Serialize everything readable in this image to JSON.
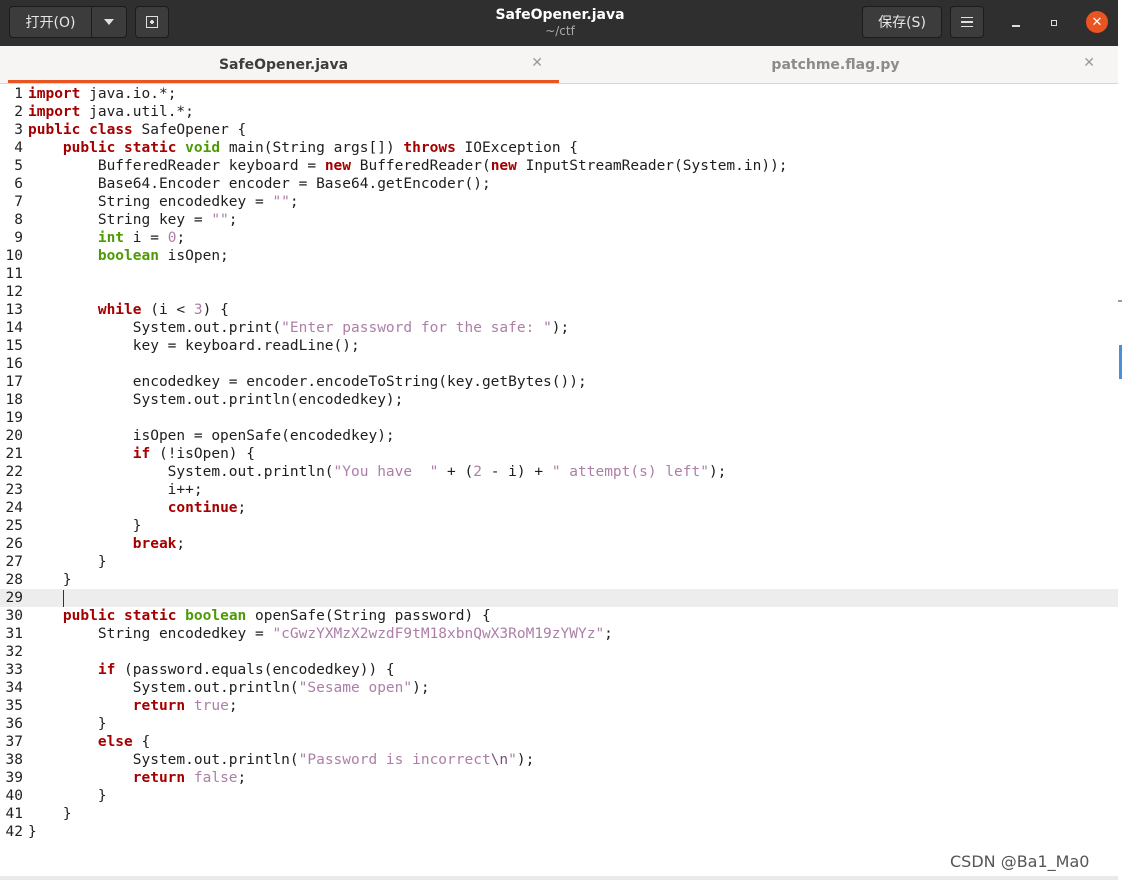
{
  "header": {
    "open_label": "打开(O)",
    "save_label": "保存(S)",
    "title": "SafeOpener.java",
    "subtitle": "~/ctf",
    "close_glyph": "✕"
  },
  "tabs": [
    {
      "label": "SafeOpener.java",
      "active": true
    },
    {
      "label": "patchme.flag.py",
      "active": false
    }
  ],
  "tab_close_glyph": "✕",
  "editor": {
    "current_line": 29,
    "lines": [
      {
        "n": "1",
        "segs": [
          [
            "kw",
            "import"
          ],
          [
            "p",
            " java.io.*;"
          ]
        ]
      },
      {
        "n": "2",
        "segs": [
          [
            "kw",
            "import"
          ],
          [
            "p",
            " java.util.*;"
          ]
        ]
      },
      {
        "n": "3",
        "segs": [
          [
            "kw",
            "public"
          ],
          [
            "p",
            " "
          ],
          [
            "kw",
            "class"
          ],
          [
            "p",
            " SafeOpener {"
          ]
        ]
      },
      {
        "n": "4",
        "segs": [
          [
            "p",
            "    "
          ],
          [
            "kw",
            "public"
          ],
          [
            "p",
            " "
          ],
          [
            "kw",
            "static"
          ],
          [
            "p",
            " "
          ],
          [
            "ty",
            "void"
          ],
          [
            "p",
            " main(String args[]) "
          ],
          [
            "kw",
            "throws"
          ],
          [
            "p",
            " IOException {"
          ]
        ]
      },
      {
        "n": "5",
        "segs": [
          [
            "p",
            "        BufferedReader keyboard = "
          ],
          [
            "kw",
            "new"
          ],
          [
            "p",
            " BufferedReader("
          ],
          [
            "kw",
            "new"
          ],
          [
            "p",
            " InputStreamReader(System.in));"
          ]
        ]
      },
      {
        "n": "6",
        "segs": [
          [
            "p",
            "        Base64.Encoder encoder = Base64.getEncoder();"
          ]
        ]
      },
      {
        "n": "7",
        "segs": [
          [
            "p",
            "        String encodedkey = "
          ],
          [
            "str",
            "\"\""
          ],
          [
            "p",
            ";"
          ]
        ]
      },
      {
        "n": "8",
        "segs": [
          [
            "p",
            "        String key = "
          ],
          [
            "str",
            "\"\""
          ],
          [
            "p",
            ";"
          ]
        ]
      },
      {
        "n": "9",
        "segs": [
          [
            "p",
            "        "
          ],
          [
            "ty",
            "int"
          ],
          [
            "p",
            " i = "
          ],
          [
            "num",
            "0"
          ],
          [
            "p",
            ";"
          ]
        ]
      },
      {
        "n": "10",
        "segs": [
          [
            "p",
            "        "
          ],
          [
            "ty",
            "boolean"
          ],
          [
            "p",
            " isOpen;"
          ]
        ]
      },
      {
        "n": "11",
        "segs": []
      },
      {
        "n": "12",
        "segs": []
      },
      {
        "n": "13",
        "segs": [
          [
            "p",
            "        "
          ],
          [
            "kw",
            "while"
          ],
          [
            "p",
            " (i < "
          ],
          [
            "num",
            "3"
          ],
          [
            "p",
            ") {"
          ]
        ]
      },
      {
        "n": "14",
        "segs": [
          [
            "p",
            "            System.out.print("
          ],
          [
            "str",
            "\"Enter password for the safe: \""
          ],
          [
            "p",
            ");"
          ]
        ]
      },
      {
        "n": "15",
        "segs": [
          [
            "p",
            "            key = keyboard.readLine();"
          ]
        ]
      },
      {
        "n": "16",
        "segs": []
      },
      {
        "n": "17",
        "segs": [
          [
            "p",
            "            encodedkey = encoder.encodeToString(key.getBytes());"
          ]
        ]
      },
      {
        "n": "18",
        "segs": [
          [
            "p",
            "            System.out.println(encodedkey);"
          ]
        ]
      },
      {
        "n": "19",
        "segs": []
      },
      {
        "n": "20",
        "segs": [
          [
            "p",
            "            isOpen = openSafe(encodedkey);"
          ]
        ]
      },
      {
        "n": "21",
        "segs": [
          [
            "p",
            "            "
          ],
          [
            "kw",
            "if"
          ],
          [
            "p",
            " (!isOpen) {"
          ]
        ]
      },
      {
        "n": "22",
        "segs": [
          [
            "p",
            "                System.out.println("
          ],
          [
            "str",
            "\"You have  \""
          ],
          [
            "p",
            " + ("
          ],
          [
            "num",
            "2"
          ],
          [
            "p",
            " - i) + "
          ],
          [
            "str",
            "\" attempt(s) left\""
          ],
          [
            "p",
            ");"
          ]
        ]
      },
      {
        "n": "23",
        "segs": [
          [
            "p",
            "                i++;"
          ]
        ]
      },
      {
        "n": "24",
        "segs": [
          [
            "p",
            "                "
          ],
          [
            "kw",
            "continue"
          ],
          [
            "p",
            ";"
          ]
        ]
      },
      {
        "n": "25",
        "segs": [
          [
            "p",
            "            }"
          ]
        ]
      },
      {
        "n": "26",
        "segs": [
          [
            "p",
            "            "
          ],
          [
            "kw",
            "break"
          ],
          [
            "p",
            ";"
          ]
        ]
      },
      {
        "n": "27",
        "segs": [
          [
            "p",
            "        }"
          ]
        ]
      },
      {
        "n": "28",
        "segs": [
          [
            "p",
            "    }"
          ]
        ]
      },
      {
        "n": "29",
        "segs": []
      },
      {
        "n": "30",
        "segs": [
          [
            "p",
            "    "
          ],
          [
            "kw",
            "public"
          ],
          [
            "p",
            " "
          ],
          [
            "kw",
            "static"
          ],
          [
            "p",
            " "
          ],
          [
            "ty",
            "boolean"
          ],
          [
            "p",
            " openSafe(String password) {"
          ]
        ]
      },
      {
        "n": "31",
        "segs": [
          [
            "p",
            "        String encodedkey = "
          ],
          [
            "str",
            "\"cGwzYXMzX2wzdF9tM18xbnQwX3RoM19zYWYz\""
          ],
          [
            "p",
            ";"
          ]
        ]
      },
      {
        "n": "32",
        "segs": []
      },
      {
        "n": "33",
        "segs": [
          [
            "p",
            "        "
          ],
          [
            "kw",
            "if"
          ],
          [
            "p",
            " (password.equals(encodedkey)) {"
          ]
        ]
      },
      {
        "n": "34",
        "segs": [
          [
            "p",
            "            System.out.println("
          ],
          [
            "str",
            "\"Sesame open\""
          ],
          [
            "p",
            ");"
          ]
        ]
      },
      {
        "n": "35",
        "segs": [
          [
            "p",
            "            "
          ],
          [
            "kw",
            "return"
          ],
          [
            "p",
            " "
          ],
          [
            "num",
            "true"
          ],
          [
            "p",
            ";"
          ]
        ]
      },
      {
        "n": "36",
        "segs": [
          [
            "p",
            "        }"
          ]
        ]
      },
      {
        "n": "37",
        "segs": [
          [
            "p",
            "        "
          ],
          [
            "kw",
            "else"
          ],
          [
            "p",
            " {"
          ]
        ]
      },
      {
        "n": "38",
        "segs": [
          [
            "p",
            "            System.out.println("
          ],
          [
            "str",
            "\"Password is incorrect"
          ],
          [
            "esc",
            "\\n"
          ],
          [
            "str",
            "\""
          ],
          [
            "p",
            ");"
          ]
        ]
      },
      {
        "n": "39",
        "segs": [
          [
            "p",
            "            "
          ],
          [
            "kw",
            "return"
          ],
          [
            "p",
            " "
          ],
          [
            "num",
            "false"
          ],
          [
            "p",
            ";"
          ]
        ]
      },
      {
        "n": "40",
        "segs": [
          [
            "p",
            "        }"
          ]
        ]
      },
      {
        "n": "41",
        "segs": [
          [
            "p",
            "    }"
          ]
        ]
      },
      {
        "n": "42",
        "segs": [
          [
            "p",
            "}"
          ]
        ]
      }
    ]
  },
  "watermark": "CSDN @Ba1_Ma0",
  "colors": {
    "keyword": "#a40000",
    "type": "#4e9a06",
    "string": "#ad7fa8",
    "accent": "#e95420"
  }
}
